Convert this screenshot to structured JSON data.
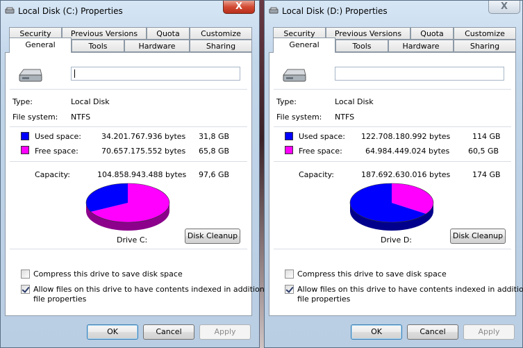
{
  "tabs_row1": [
    "Security",
    "Previous Versions",
    "Quota",
    "Customize"
  ],
  "tabs_row2": [
    "General",
    "Tools",
    "Hardware",
    "Sharing"
  ],
  "labels": {
    "type": "Type:",
    "file_system": "File system:",
    "used_space": "Used space:",
    "free_space": "Free space:",
    "capacity": "Capacity:"
  },
  "colors": {
    "used": "#0000ff",
    "free": "#ff00ff"
  },
  "compress_label": "Compress this drive to save disk space",
  "index_label_line1": "Allow files on this drive to have contents indexed in addition to",
  "index_label_line2": "file properties",
  "disk_cleanup_label": "Disk Cleanup",
  "ok_label": "OK",
  "cancel_label": "Cancel",
  "apply_label": "Apply",
  "close_label": "X",
  "windows": [
    {
      "title": "Local Disk (C:) Properties",
      "type_value": "Local Disk",
      "fs_value": "NTFS",
      "used_bytes": "34.201.767.936 bytes",
      "used_gb": "31,8 GB",
      "free_bytes": "70.657.175.552 bytes",
      "free_gb": "65,8 GB",
      "capacity_bytes": "104.858.943.488 bytes",
      "capacity_gb": "97,6 GB",
      "drive_label": "Drive C:",
      "used_fraction": 0.326,
      "compress_checked": false,
      "index_checked": true
    },
    {
      "title": "Local Disk (D:) Properties",
      "type_value": "Local Disk",
      "fs_value": "NTFS",
      "used_bytes": "122.708.180.992 bytes",
      "used_gb": "114 GB",
      "free_bytes": "64.984.449.024 bytes",
      "free_gb": "60,5 GB",
      "capacity_bytes": "187.692.630.016 bytes",
      "capacity_gb": "174 GB",
      "drive_label": "Drive D:",
      "used_fraction": 0.654,
      "compress_checked": false,
      "index_checked": true
    }
  ]
}
